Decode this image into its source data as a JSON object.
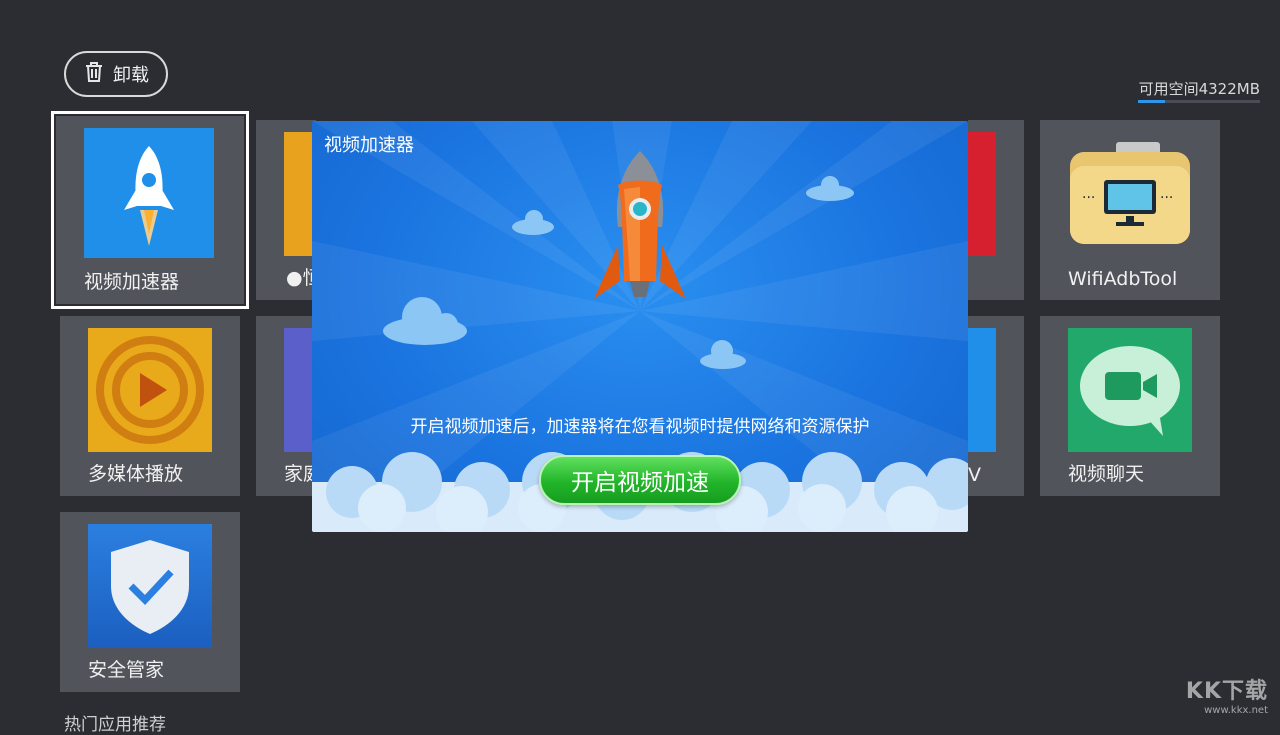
{
  "toolbar": {
    "uninstall_label": "卸载"
  },
  "storage": {
    "available_text": "可用空间4322MB",
    "used_fraction": 0.22
  },
  "apps": [
    {
      "label": "视频加速器"
    },
    {
      "label": "●恒"
    },
    {
      "label": "WifiAdbTool"
    },
    {
      "label": "多媒体播放"
    },
    {
      "label": "家庭"
    },
    {
      "label": "V"
    },
    {
      "label": "视频聊天"
    },
    {
      "label": "安全管家"
    }
  ],
  "section": {
    "recommended_title": "热门应用推荐"
  },
  "dialog": {
    "title": "视频加速器",
    "description": "开启视频加速后，加速器将在您看视频时提供网络和资源保护",
    "button_label": "开启视频加速"
  },
  "watermark": {
    "logo": "KK下载",
    "url": "www.kkx.net"
  },
  "colors": {
    "background": "#2b2d33",
    "tile": "#52545c",
    "dialog_blue": "#1a73df",
    "button_green": "#22b52a",
    "accent": "#2f95e8"
  }
}
